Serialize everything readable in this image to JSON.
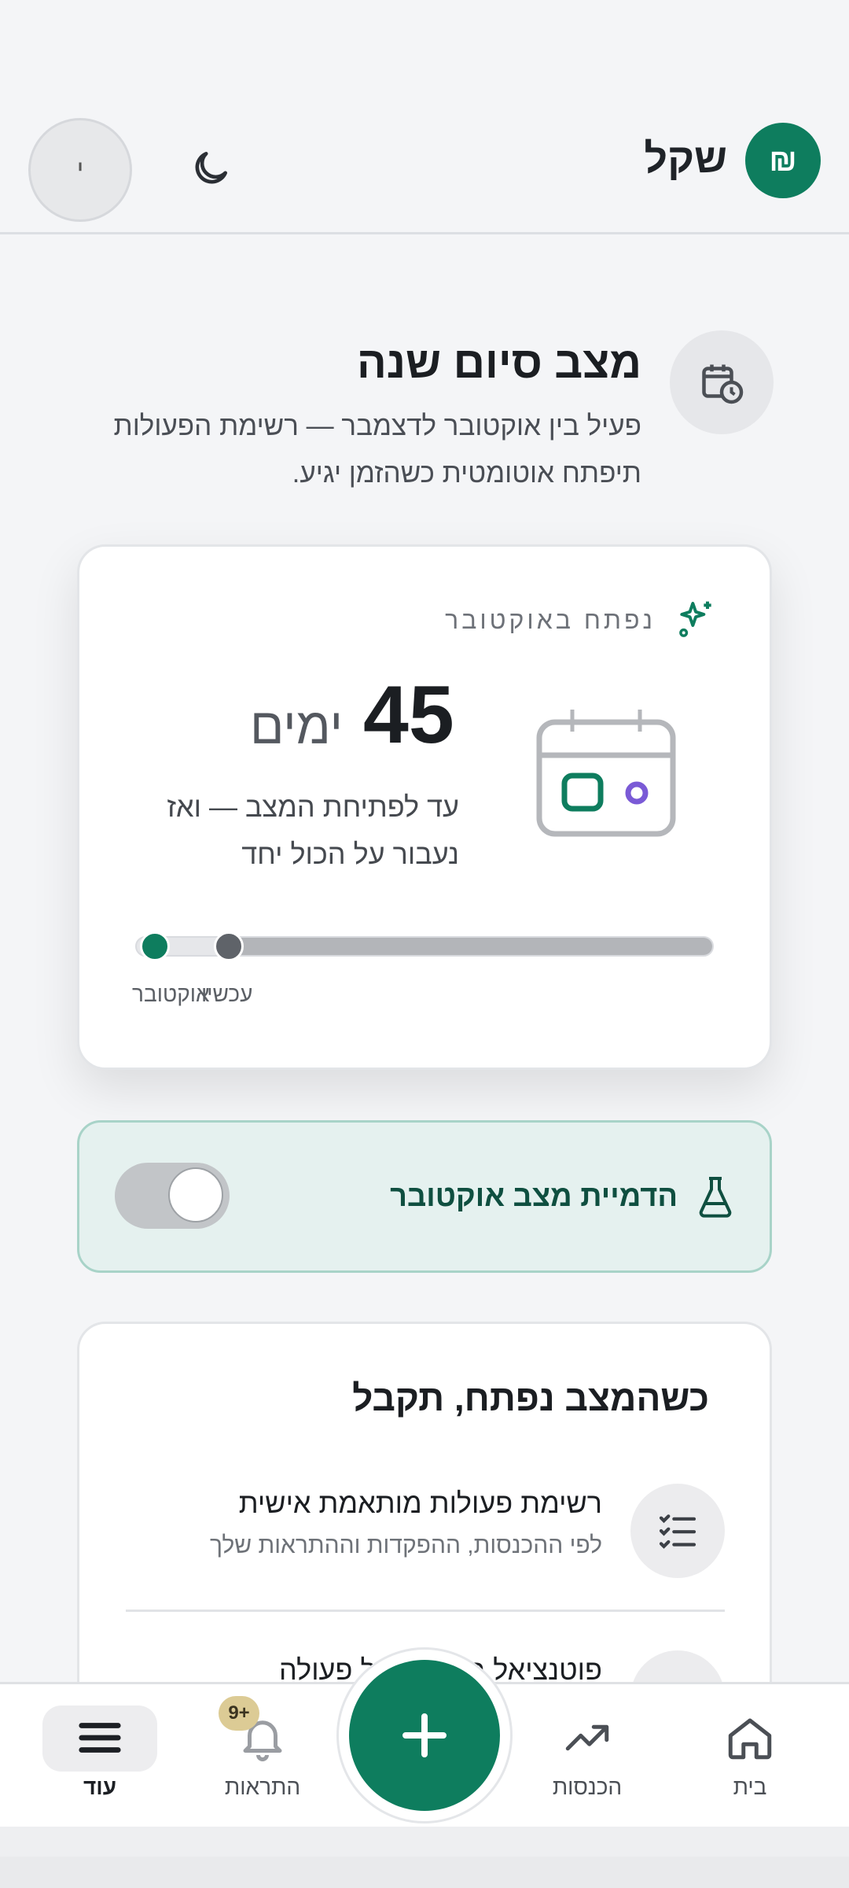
{
  "header": {
    "brand_symbol": "₪",
    "brand_name": "שקל",
    "avatar_initial": "י",
    "theme_icon": "moon-icon"
  },
  "section": {
    "title": "מצב סיום שנה",
    "description": "פעיל בין אוקטובר לדצמבר — רשימת הפעולות תיפתח אוטומטית כשהזמן יגיע."
  },
  "countdown": {
    "opens_label": "נפתח באוקטובר",
    "days_value": "45",
    "days_unit": "ימים",
    "until_text": "עד לפתיחת המצב — ואז נעבור על הכול יחד",
    "progress_fraction": 0.12,
    "label_october": "אוקטובר",
    "label_now": "עכשיו"
  },
  "simulation": {
    "label": "הדמיית מצב אוקטובר",
    "enabled": false
  },
  "benefits": {
    "title": "כשהמצב נפתח, תקבל",
    "items": [
      {
        "title": "רשימת פעולות מותאמת אישית",
        "subtitle": "לפי ההכנסות, ההפקדות וההתראות שלך"
      },
      {
        "title": "פוטנציאל חיסכון לכל פעולה"
      }
    ]
  },
  "nav": {
    "home": "בית",
    "income": "הכנסות",
    "alerts": "התראות",
    "alerts_badge": "9+",
    "more": "עוד"
  },
  "colors": {
    "accent": "#0e7d5e",
    "purple": "#7a5ad6",
    "badge": "#dccb95"
  }
}
